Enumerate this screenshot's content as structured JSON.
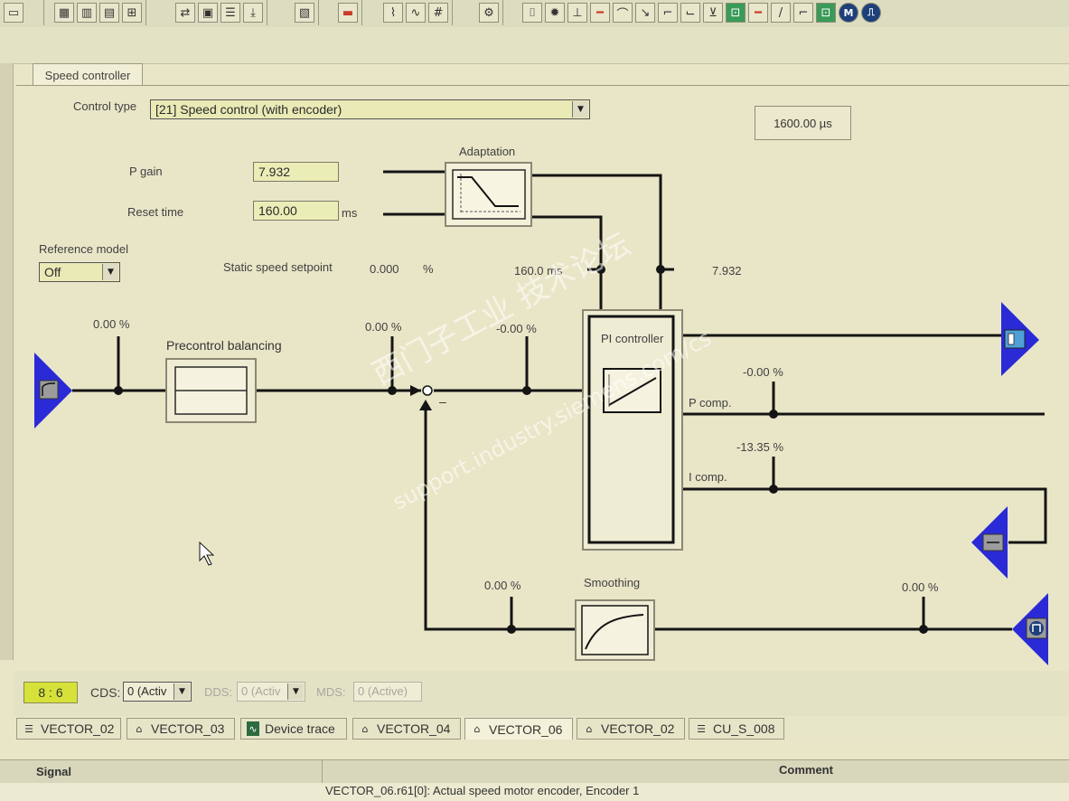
{
  "toolbar": {
    "icons": [
      "window-icon",
      "component-icon",
      "chart-icon",
      "table-icon",
      "signal-icon",
      "connect-icon",
      "device-icon",
      "list-icon",
      "download-icon",
      "layout-icon",
      "trend-icon",
      "trace-icon",
      "oscilloscope-icon",
      "grid-icon",
      "gear-icon",
      "step-icon",
      "level-icon",
      "ramp-icon",
      "filter-icon",
      "curve-icon",
      "active-speed-icon",
      "motor-model-icon",
      "encoder-icon",
      "limit-icon",
      "slope-icon",
      "gain-icon",
      "drive-icon",
      "motor-icon",
      "pulse-icon"
    ],
    "accent_green": "#3a9a58",
    "accent_blue": "#1d3f7a"
  },
  "tab": {
    "label": "Speed controller"
  },
  "control": {
    "label": "Control type",
    "value": "[21] Speed control (with encoder)",
    "sample_time": "1600.00 µs"
  },
  "params": {
    "p_gain_label": "P gain",
    "p_gain_value": "7.932",
    "reset_time_label": "Reset time",
    "reset_time_value": "160.00",
    "reset_time_unit": "ms",
    "reference_model_label": "Reference model",
    "reference_model_value": "Off",
    "static_setpoint_label": "Static speed setpoint",
    "static_setpoint_value": "0.000",
    "static_setpoint_unit": "%"
  },
  "diagram": {
    "adaptation_label": "Adaptation",
    "reset_time_readout": "160.0 ms",
    "p_gain_readout": "7.932",
    "input_value": "0.00 %",
    "precontrol_label": "Precontrol balancing",
    "precontrol_out_value": "0.00 %",
    "error_value": "-0.00 %",
    "minus_sign": "–",
    "pi_label": "PI controller",
    "p_comp_label": "P comp.",
    "p_comp_value": "-0.00 %",
    "i_comp_label": "I comp.",
    "i_comp_value": "-13.35 %",
    "smoothing_label": "Smoothing",
    "feedback_value": "0.00 %",
    "actual_value": "0.00 %",
    "connector_color": "#2a2ad6"
  },
  "status": {
    "position": "8 : 6",
    "cds_label": "CDS:",
    "cds_value": "0 (Activ",
    "dds_label": "DDS:",
    "dds_value": "0 (Activ",
    "mds_label": "MDS:",
    "mds_value": "0 (Active)"
  },
  "doc_tabs": [
    {
      "label": "VECTOR_02",
      "icon": "list-icon"
    },
    {
      "label": "VECTOR_03",
      "icon": "drive-icon"
    },
    {
      "label": "Device trace",
      "icon": "trace-icon"
    },
    {
      "label": "VECTOR_04",
      "icon": "drive-icon"
    },
    {
      "label": "VECTOR_06",
      "icon": "drive-icon"
    },
    {
      "label": "VECTOR_02",
      "icon": "drive-icon"
    },
    {
      "label": "CU_S_008",
      "icon": "list-icon"
    }
  ],
  "grid": {
    "signal_header": "Signal",
    "comment_header": "Comment",
    "row_text": "VECTOR_06.r61[0]: Actual speed motor encoder, Encoder 1"
  },
  "watermark": {
    "line1": "西门子工业   技术论坛",
    "line2": "support.industry.siemens.com/cs"
  }
}
